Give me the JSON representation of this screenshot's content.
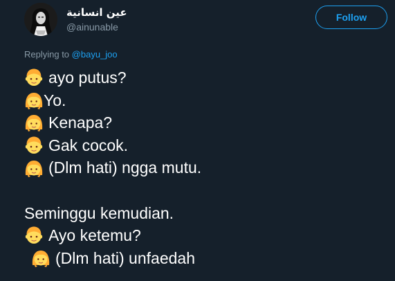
{
  "header": {
    "display_name": "عين انسانية",
    "handle": "@ainunable",
    "follow_label": "Follow",
    "avatar_icon": "user-avatar"
  },
  "reply": {
    "prefix": "Replying to",
    "user": "@bayu_joo"
  },
  "tweet": {
    "lines": [
      {
        "emoji": "boy-emoji",
        "text": "ayo putus?"
      },
      {
        "emoji": "girl-emoji",
        "text": "Yo."
      },
      {
        "emoji": "girl-emoji",
        "text": "Kenapa?"
      },
      {
        "emoji": "boy-emoji",
        "text": "Gak cocok."
      },
      {
        "emoji": "girl-emoji",
        "text": "(Dlm hati) ngga mutu."
      },
      {
        "text": "Seminggu kemudian."
      },
      {
        "emoji": "boy-emoji",
        "text": "Ayo ketemu?"
      },
      {
        "emoji": "girl-emoji",
        "text": "(Dlm hati) unfaedah"
      }
    ]
  },
  "colors": {
    "background": "#15202b",
    "accent": "#1da1f2",
    "secondary_text": "#8899a6",
    "primary_text": "#ffffff"
  }
}
